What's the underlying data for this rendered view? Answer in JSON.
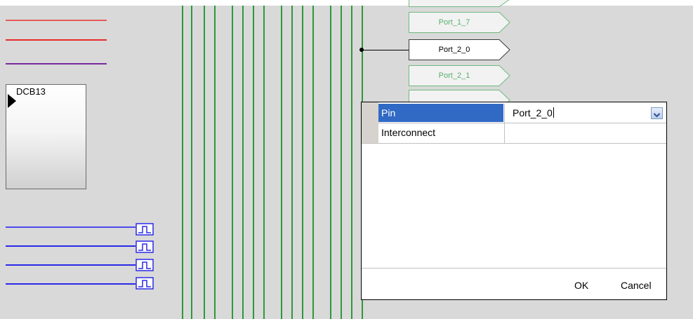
{
  "canvas": {
    "component_label": "DCB13",
    "ports": [
      {
        "label": "Port_1_7",
        "active": false
      },
      {
        "label": "Port_2_0",
        "active": true
      },
      {
        "label": "Port_2_1",
        "active": false
      }
    ]
  },
  "dialog": {
    "rows": [
      {
        "label": "Pin",
        "value": "Port_2_0"
      },
      {
        "label": "Interconnect",
        "value": ""
      }
    ],
    "ok_label": "OK",
    "cancel_label": "Cancel"
  },
  "colors": {
    "canvas_bg": "#d9d9d9",
    "wire_green": "#2a9a3a",
    "wire_red": "#e82a2a",
    "wire_purple": "#7a2aa0",
    "wire_blue": "#2a2ae8",
    "selection_blue": "#316ac5",
    "port_text_inactive": "#57b06b"
  }
}
